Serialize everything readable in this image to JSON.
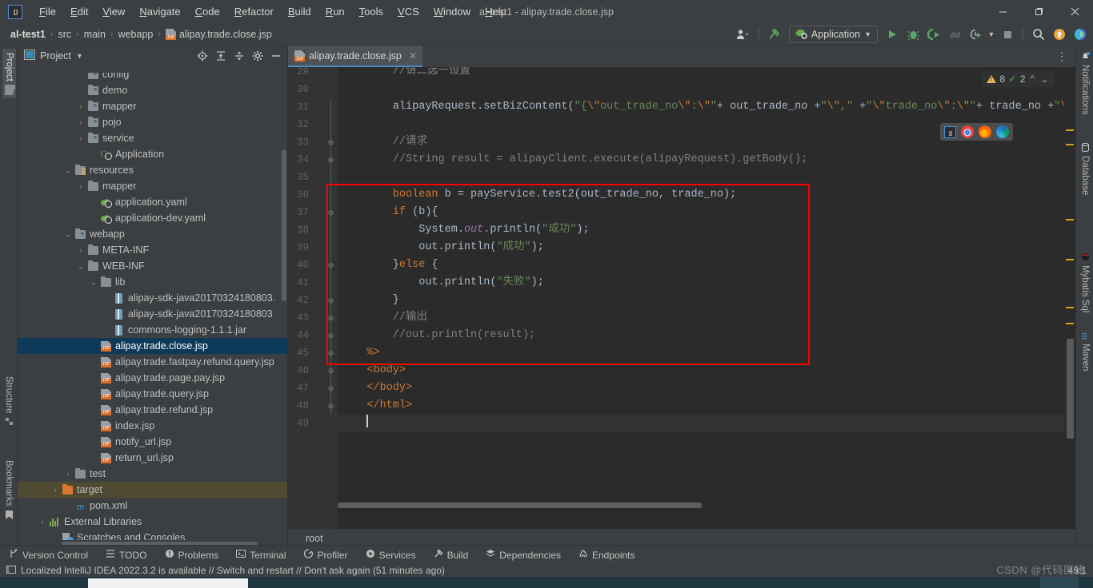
{
  "window": {
    "title": "al-test1 - alipay.trade.close.jsp",
    "minimize": "—",
    "maximize": "❐",
    "close": "✕"
  },
  "menubar": [
    {
      "label": "File",
      "accel": "F"
    },
    {
      "label": "Edit",
      "accel": "E"
    },
    {
      "label": "View",
      "accel": "V"
    },
    {
      "label": "Navigate",
      "accel": "N"
    },
    {
      "label": "Code",
      "accel": "C"
    },
    {
      "label": "Refactor",
      "accel": "R"
    },
    {
      "label": "Build",
      "accel": "B"
    },
    {
      "label": "Run",
      "accel": "R"
    },
    {
      "label": "Tools",
      "accel": "T"
    },
    {
      "label": "VCS",
      "accel": "V"
    },
    {
      "label": "Window",
      "accel": "W"
    },
    {
      "label": "Help",
      "accel": "H"
    }
  ],
  "navbar": {
    "crumbs": [
      "al-test1",
      "src",
      "main",
      "webapp",
      "alipay.trade.close.jsp"
    ],
    "separator": "›",
    "file_icon": "jsp-file-icon",
    "run_config": "Application",
    "icons": {
      "user": "user-avatar-icon",
      "build": "hammer-build-icon",
      "run": "run-icon",
      "debug": "debug-icon",
      "run_coverage": "run-with-coverage-icon",
      "profile": "profiler-icon",
      "run_history": "run-history-icon",
      "stop": "stop-icon",
      "search": "search-icon",
      "update": "update-available-icon",
      "ide_features": "ide-feature-icon"
    }
  },
  "left_strip": [
    {
      "label": "Project",
      "active": true
    },
    {
      "label": "Structure",
      "active": false
    },
    {
      "label": "Bookmarks",
      "active": false
    }
  ],
  "right_strip": [
    {
      "label": "Notifications",
      "icon": "bell-icon"
    },
    {
      "label": "Database",
      "icon": "database-icon"
    },
    {
      "label": "Mybatis Sql",
      "icon": "mybatis-icon"
    },
    {
      "label": "Maven",
      "icon": "maven-icon"
    }
  ],
  "project_panel": {
    "title": "Project",
    "dropdown": "▾",
    "icons": [
      "locate-icon",
      "expand-all-icon",
      "collapse-all-icon",
      "settings-gear-icon",
      "hide-panel-icon"
    ],
    "tree": [
      {
        "label": "config",
        "indent": 4,
        "twist": "",
        "icon": "package-icon",
        "clipped": true
      },
      {
        "label": "demo",
        "indent": 4,
        "twist": "",
        "icon": "package-icon"
      },
      {
        "label": "mapper",
        "indent": 4,
        "twist": "›",
        "icon": "package-icon"
      },
      {
        "label": "pojo",
        "indent": 4,
        "twist": "›",
        "icon": "package-icon"
      },
      {
        "label": "service",
        "indent": 4,
        "twist": "›",
        "icon": "package-icon"
      },
      {
        "label": "Application",
        "indent": 5,
        "twist": "",
        "icon": "spring-class-icon"
      },
      {
        "label": "resources",
        "indent": 3,
        "twist": "⌄",
        "icon": "resources-folder-icon"
      },
      {
        "label": "mapper",
        "indent": 4,
        "twist": "›",
        "icon": "folder-icon"
      },
      {
        "label": "application.yaml",
        "indent": 5,
        "twist": "",
        "icon": "spring-yaml-icon"
      },
      {
        "label": "application-dev.yaml",
        "indent": 5,
        "twist": "",
        "icon": "spring-yaml-icon"
      },
      {
        "label": "webapp",
        "indent": 3,
        "twist": "⌄",
        "icon": "webapp-folder-icon"
      },
      {
        "label": "META-INF",
        "indent": 4,
        "twist": "›",
        "icon": "folder-icon"
      },
      {
        "label": "WEB-INF",
        "indent": 4,
        "twist": "⌄",
        "icon": "folder-icon"
      },
      {
        "label": "lib",
        "indent": 5,
        "twist": "⌄",
        "icon": "folder-icon"
      },
      {
        "label": "alipay-sdk-java20170324180803.",
        "indent": 6,
        "twist": "",
        "icon": "jar-icon"
      },
      {
        "label": "alipay-sdk-java20170324180803",
        "indent": 6,
        "twist": "",
        "icon": "jar-icon"
      },
      {
        "label": "commons-logging-1.1.1.jar",
        "indent": 6,
        "twist": "",
        "icon": "jar-icon"
      },
      {
        "label": "alipay.trade.close.jsp",
        "indent": 5,
        "twist": "",
        "icon": "jsp-file-icon",
        "selected": true
      },
      {
        "label": "alipay.trade.fastpay.refund.query.jsp",
        "indent": 5,
        "twist": "",
        "icon": "jsp-file-icon"
      },
      {
        "label": "alipay.trade.page.pay.jsp",
        "indent": 5,
        "twist": "",
        "icon": "jsp-file-icon"
      },
      {
        "label": "alipay.trade.query.jsp",
        "indent": 5,
        "twist": "",
        "icon": "jsp-file-icon"
      },
      {
        "label": "alipay.trade.refund.jsp",
        "indent": 5,
        "twist": "",
        "icon": "jsp-file-icon"
      },
      {
        "label": "index.jsp",
        "indent": 5,
        "twist": "",
        "icon": "jsp-file-icon"
      },
      {
        "label": "notify_url.jsp",
        "indent": 5,
        "twist": "",
        "icon": "jsp-file-icon"
      },
      {
        "label": "return_url.jsp",
        "indent": 5,
        "twist": "",
        "icon": "jsp-file-icon"
      },
      {
        "label": "test",
        "indent": 3,
        "twist": "›",
        "icon": "folder-icon"
      },
      {
        "label": "target",
        "indent": 2,
        "twist": "›",
        "icon": "target-folder-icon",
        "highlight": true
      },
      {
        "label": "pom.xml",
        "indent": 3,
        "twist": "",
        "icon": "maven-pom-icon"
      },
      {
        "label": "External Libraries",
        "indent": 1,
        "twist": "›",
        "icon": "external-libraries-icon"
      },
      {
        "label": "Scratches and Consoles",
        "indent": 2,
        "twist": "",
        "icon": "scratches-icon"
      }
    ]
  },
  "editor": {
    "tab": {
      "label": "alipay.trade.close.jsp",
      "icon": "jsp-file-icon",
      "close": "✕"
    },
    "tab_more": "⋮",
    "inspections": {
      "warning_icon": "warning-triangle-icon",
      "warning_count": "8",
      "ok_icon": "inspections-ok-icon",
      "ok_count": "2",
      "prev": "⌃",
      "next": "⌄"
    },
    "browser_popup": [
      "intellij-preview-icon",
      "chrome-icon",
      "firefox-icon",
      "edge-icon"
    ],
    "breadcrumb": "root",
    "first_line": 29,
    "caret_line": 49,
    "lines": [
      {
        "n": 29,
        "tokens": [
          {
            "t": "cmt",
            "v": "        //请二选一设置"
          }
        ]
      },
      {
        "n": 30,
        "tokens": []
      },
      {
        "n": 31,
        "tokens": [
          {
            "t": "txt",
            "v": "        alipayRequest.setBizContent("
          },
          {
            "t": "str",
            "v": "\"{"
          },
          {
            "t": "esc",
            "v": "\\\""
          },
          {
            "t": "str",
            "v": "out_trade_no"
          },
          {
            "t": "esc",
            "v": "\\\""
          },
          {
            "t": "str",
            "v": ":"
          },
          {
            "t": "esc",
            "v": "\\\""
          },
          {
            "t": "str",
            "v": "\""
          },
          {
            "t": "txt",
            "v": "+ out_trade_no +"
          },
          {
            "t": "str",
            "v": "\""
          },
          {
            "t": "esc",
            "v": "\\\""
          },
          {
            "t": "str",
            "v": ",\" "
          },
          {
            "t": "txt",
            "v": "+"
          },
          {
            "t": "str",
            "v": "\""
          },
          {
            "t": "esc",
            "v": "\\\""
          },
          {
            "t": "str",
            "v": "trade_no"
          },
          {
            "t": "esc",
            "v": "\\\""
          },
          {
            "t": "str",
            "v": ":"
          },
          {
            "t": "esc",
            "v": "\\\""
          },
          {
            "t": "str",
            "v": "\""
          },
          {
            "t": "txt",
            "v": "+ trade_no +"
          },
          {
            "t": "str",
            "v": "\""
          },
          {
            "t": "esc",
            "v": "\\\""
          },
          {
            "t": "str",
            "v": "}\""
          },
          {
            "t": "txt",
            "v": ");"
          }
        ]
      },
      {
        "n": 32,
        "tokens": []
      },
      {
        "n": 33,
        "tokens": [
          {
            "t": "cmt",
            "v": "        //请求"
          }
        ]
      },
      {
        "n": 34,
        "tokens": [
          {
            "t": "cmt",
            "v": "        //String result = alipayClient.execute(alipayRequest).getBody();"
          }
        ]
      },
      {
        "n": 35,
        "tokens": []
      },
      {
        "n": 36,
        "tokens": [
          {
            "t": "key",
            "v": "        boolean"
          },
          {
            "t": "txt",
            "v": " b = payService.test2(out_trade_no, trade_no);"
          }
        ]
      },
      {
        "n": 37,
        "tokens": [
          {
            "t": "key",
            "v": "        if"
          },
          {
            "t": "txt",
            "v": " (b){"
          }
        ]
      },
      {
        "n": 38,
        "tokens": [
          {
            "t": "txt",
            "v": "            System."
          },
          {
            "t": "fld",
            "v": "out"
          },
          {
            "t": "txt",
            "v": ".println("
          },
          {
            "t": "str",
            "v": "\"成功\""
          },
          {
            "t": "txt",
            "v": ");"
          }
        ]
      },
      {
        "n": 39,
        "tokens": [
          {
            "t": "txt",
            "v": "            out.println("
          },
          {
            "t": "str",
            "v": "\"成功\""
          },
          {
            "t": "txt",
            "v": ");"
          }
        ]
      },
      {
        "n": 40,
        "tokens": [
          {
            "t": "txt",
            "v": "        }"
          },
          {
            "t": "key",
            "v": "else"
          },
          {
            "t": "txt",
            "v": " {"
          }
        ]
      },
      {
        "n": 41,
        "tokens": [
          {
            "t": "txt",
            "v": "            out.println("
          },
          {
            "t": "str",
            "v": "\"失败\""
          },
          {
            "t": "txt",
            "v": ");"
          }
        ]
      },
      {
        "n": 42,
        "tokens": [
          {
            "t": "txt",
            "v": "        }"
          }
        ]
      },
      {
        "n": 43,
        "tokens": [
          {
            "t": "cmt",
            "v": "        //输出"
          }
        ]
      },
      {
        "n": 44,
        "tokens": [
          {
            "t": "cmt",
            "v": "        //out.println(result);"
          }
        ]
      },
      {
        "n": 45,
        "tokens": [
          {
            "t": "key",
            "v": "    %>"
          }
        ]
      },
      {
        "n": 46,
        "tokens": [
          {
            "t": "key",
            "v": "    <body>"
          }
        ]
      },
      {
        "n": 47,
        "tokens": [
          {
            "t": "key",
            "v": "    </body>"
          }
        ]
      },
      {
        "n": 48,
        "tokens": [
          {
            "t": "key",
            "v": "    </html>"
          }
        ]
      },
      {
        "n": 49,
        "tokens": [],
        "caret": true
      }
    ]
  },
  "tool_windows": [
    {
      "label": "Version Control",
      "icon": "branch-icon"
    },
    {
      "label": "TODO",
      "icon": "todo-list-icon"
    },
    {
      "label": "Problems",
      "icon": "problems-icon"
    },
    {
      "label": "Terminal",
      "icon": "terminal-icon"
    },
    {
      "label": "Profiler",
      "icon": "profiler-icon"
    },
    {
      "label": "Services",
      "icon": "services-icon"
    },
    {
      "label": "Build",
      "icon": "hammer-build-icon"
    },
    {
      "label": "Dependencies",
      "icon": "dependencies-icon"
    },
    {
      "label": "Endpoints",
      "icon": "endpoints-icon"
    }
  ],
  "statusbar": {
    "icon": "event-log-icon",
    "message": "Localized IntelliJ IDEA 2022.3.2 is available // Switch and restart // Don't ask again (51 minutes ago)",
    "caret_position": "49:1",
    "watermark": "CSDN @代码匪徒"
  }
}
